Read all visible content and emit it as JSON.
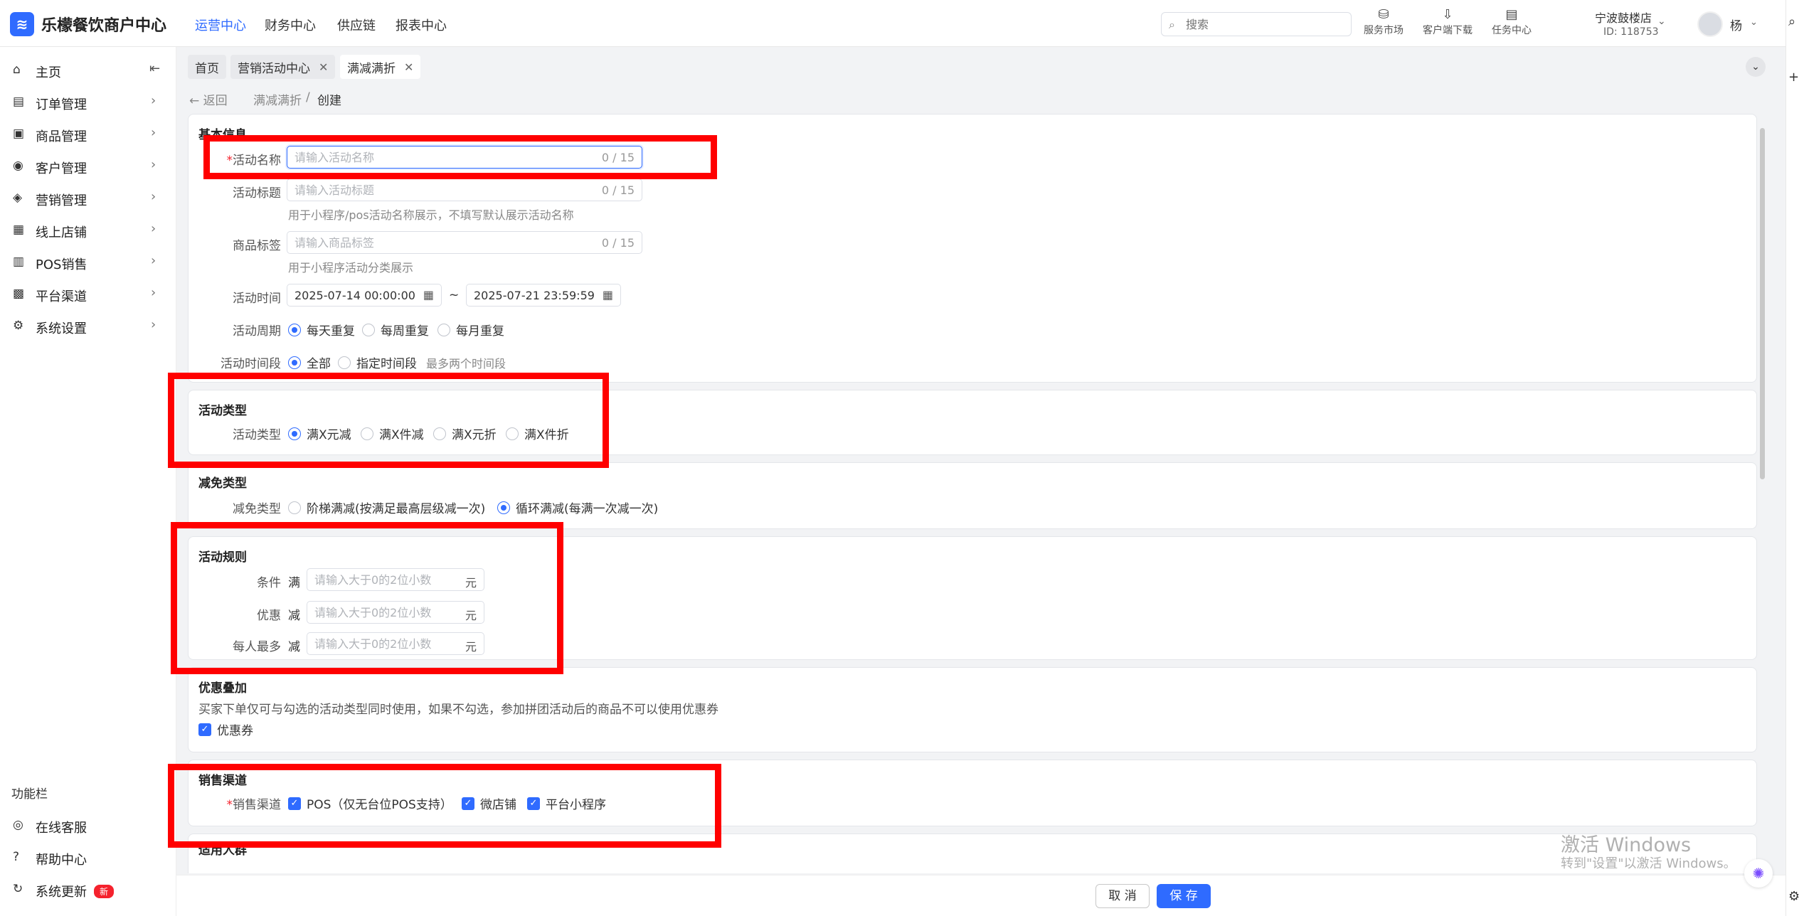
{
  "app": {
    "logo_char": "≋",
    "title": "乐檬餐饮商户中心"
  },
  "topnav": [
    "运营中心",
    "财务中心",
    "供应链",
    "报表中心"
  ],
  "search": {
    "placeholder": "搜索",
    "icon": "search-icon"
  },
  "tools": [
    {
      "label": "服务市场",
      "icon": "store-icon",
      "glyph": "⛁"
    },
    {
      "label": "客户端下载",
      "icon": "download-icon",
      "glyph": "⇩"
    },
    {
      "label": "任务中心",
      "icon": "task-icon",
      "glyph": "▤"
    }
  ],
  "store": {
    "name": "宁波鼓楼店",
    "id": "ID: 118753"
  },
  "user": {
    "name": "杨"
  },
  "sidebar": {
    "items": [
      {
        "label": "主页",
        "icon": "home-icon",
        "glyph": "⌂"
      },
      {
        "label": "订单管理",
        "icon": "order-icon",
        "glyph": "▤"
      },
      {
        "label": "商品管理",
        "icon": "goods-icon",
        "glyph": "▣"
      },
      {
        "label": "客户管理",
        "icon": "customer-icon",
        "glyph": "◉"
      },
      {
        "label": "营销管理",
        "icon": "tag-icon",
        "glyph": "◈"
      },
      {
        "label": "线上店铺",
        "icon": "shop-icon",
        "glyph": "▦"
      },
      {
        "label": "POS销售",
        "icon": "pos-icon",
        "glyph": "▥"
      },
      {
        "label": "平台渠道",
        "icon": "platform-icon",
        "glyph": "▩"
      },
      {
        "label": "系统设置",
        "icon": "settings-icon",
        "glyph": "⚙"
      }
    ],
    "func_title": "功能栏",
    "func_items": [
      {
        "label": "在线客服",
        "icon": "chat-icon",
        "glyph": "◎"
      },
      {
        "label": "帮助中心",
        "icon": "help-icon",
        "glyph": "?"
      },
      {
        "label": "系统更新",
        "icon": "refresh-icon",
        "glyph": "↻",
        "badge": "新"
      }
    ]
  },
  "tabs": [
    {
      "label": "首页",
      "closable": false
    },
    {
      "label": "营销活动中心",
      "closable": true
    },
    {
      "label": "满减满折",
      "closable": true
    }
  ],
  "breadcrumb": {
    "back": "返回",
    "parent": "满减满折",
    "current": "创建"
  },
  "basic": {
    "title": "基本信息",
    "name_label": "活动名称",
    "name_placeholder": "请输入活动名称",
    "name_count": "0 / 15",
    "subtitle_label": "活动标题",
    "subtitle_placeholder": "请输入活动标题",
    "subtitle_count": "0 / 15",
    "subtitle_help": "用于小程序/pos活动名称展示，不填写默认展示活动名称",
    "tag_label": "商品标签",
    "tag_placeholder": "请输入商品标签",
    "tag_count": "0 / 15",
    "tag_help": "用于小程序活动分类展示",
    "time_label": "活动时间",
    "start_time": "2025-07-14 00:00:00",
    "end_time": "2025-07-21 23:59:59",
    "time_sep": "~",
    "cycle_label": "活动周期",
    "cycle_options": [
      "每天重复",
      "每周重复",
      "每月重复"
    ],
    "period_label": "活动时间段",
    "period_options": [
      "全部",
      "指定时间段"
    ],
    "period_hint": "最多两个时间段"
  },
  "type": {
    "title": "活动类型",
    "label": "活动类型",
    "options": [
      "满X元减",
      "满X件减",
      "满X元折",
      "满X件折"
    ]
  },
  "reduce": {
    "title": "减免类型",
    "label": "减免类型",
    "options": [
      "阶梯满减(按满足最高层级减一次)",
      "循环满减(每满一次减一次)"
    ]
  },
  "rules": {
    "title": "活动规则",
    "rows": [
      {
        "label": "条件",
        "prefix": "满",
        "placeholder": "请输入大于0的2位小数",
        "unit": "元"
      },
      {
        "label": "优惠",
        "prefix": "减",
        "placeholder": "请输入大于0的2位小数",
        "unit": "元"
      },
      {
        "label": "每人最多",
        "prefix": "减",
        "placeholder": "请输入大于0的2位小数",
        "unit": "元"
      }
    ]
  },
  "stack": {
    "title": "优惠叠加",
    "desc": "买家下单仅可与勾选的活动类型同时使用，如果不勾选，参加拼团活动后的商品不可以使用优惠券",
    "option": "优惠券"
  },
  "channel": {
    "title": "销售渠道",
    "label": "销售渠道",
    "options": [
      "POS（仅无台位POS支持）",
      "微店铺",
      "平台小程序"
    ]
  },
  "audience": {
    "title": "适用人群"
  },
  "footer": {
    "cancel": "取 消",
    "save": "保 存"
  },
  "watermark": {
    "line1": "激活 Windows",
    "line2": "转到\"设置\"以激活 Windows。"
  },
  "colors": {
    "accent": "#2f6bff",
    "annotation": "#ff0000",
    "required": "#f5222d"
  }
}
